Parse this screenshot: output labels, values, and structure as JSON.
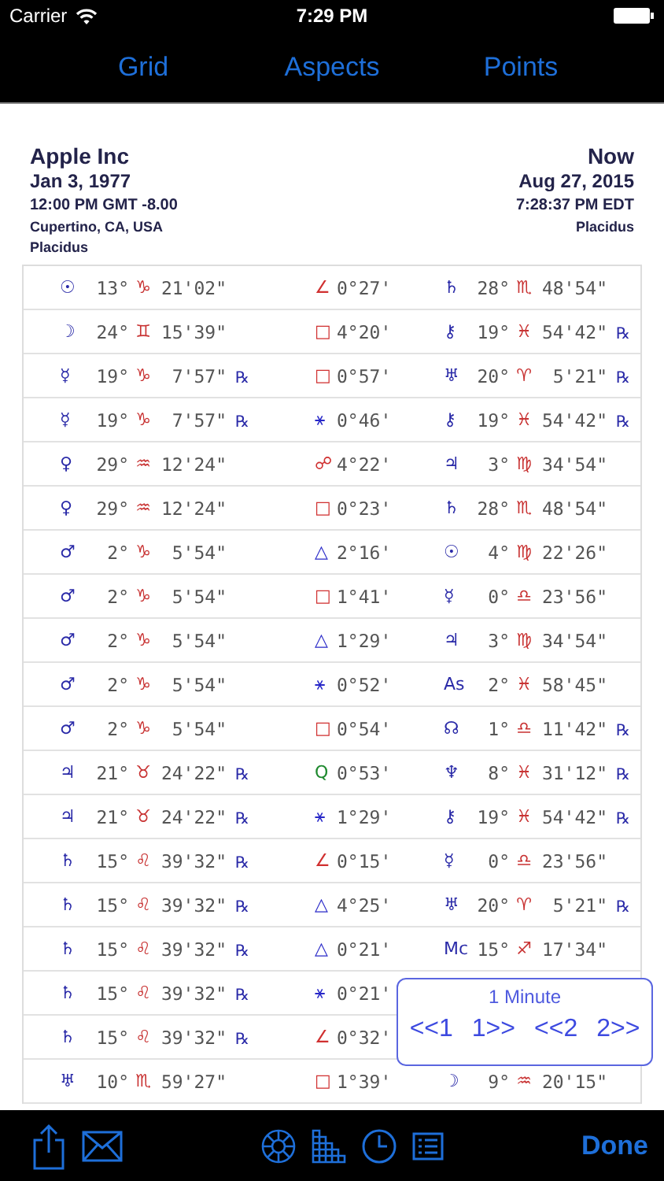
{
  "status_bar": {
    "carrier": "Carrier",
    "time": "7:29 PM"
  },
  "tabs": [
    {
      "label": "Grid",
      "selected": false
    },
    {
      "label": "Aspects",
      "selected": false
    },
    {
      "label": "Points",
      "selected": false
    }
  ],
  "chart1": {
    "name": "Apple Inc",
    "date": "Jan 3, 1977",
    "time": "12:00 PM GMT -8.00",
    "place": "Cupertino, CA, USA",
    "house_system": "Placidus"
  },
  "chart2": {
    "name": "Now",
    "date": "Aug 27, 2015",
    "time": "7:28:37 PM EDT",
    "house_system": "Placidus"
  },
  "rows": [
    {
      "p1": {
        "glyph": "☉",
        "deg": "13°",
        "sign": "♑",
        "min": "21'02\""
      },
      "aspect": {
        "glyph": "∠",
        "orb": "0°27'",
        "color": "#d03030"
      },
      "p2": {
        "glyph": "♄",
        "deg": "28°",
        "sign": "♏",
        "min": "48'54\""
      }
    },
    {
      "p1": {
        "glyph": "☽",
        "deg": "24°",
        "sign": "♊",
        "min": "15'39\""
      },
      "aspect": {
        "glyph": "□",
        "orb": "4°20'",
        "color": "#d03030"
      },
      "p2": {
        "glyph": "⚷",
        "deg": "19°",
        "sign": "♓",
        "min": "54'42\"",
        "retro": "℞"
      }
    },
    {
      "p1": {
        "glyph": "☿",
        "deg": "19°",
        "sign": "♑",
        "min": "7'57\"",
        "retro": "℞"
      },
      "aspect": {
        "glyph": "□",
        "orb": "0°57'",
        "color": "#d03030"
      },
      "p2": {
        "glyph": "♅",
        "deg": "20°",
        "sign": "♈",
        "min": "5'21\"",
        "retro": "℞"
      }
    },
    {
      "p1": {
        "glyph": "☿",
        "deg": "19°",
        "sign": "♑",
        "min": "7'57\"",
        "retro": "℞"
      },
      "aspect": {
        "glyph": "⚹",
        "orb": "0°46'",
        "color": "#2828c8"
      },
      "p2": {
        "glyph": "⚷",
        "deg": "19°",
        "sign": "♓",
        "min": "54'42\"",
        "retro": "℞"
      }
    },
    {
      "p1": {
        "glyph": "♀",
        "deg": "29°",
        "sign": "♒",
        "min": "12'24\""
      },
      "aspect": {
        "glyph": "☍",
        "orb": "4°22'",
        "color": "#d03030"
      },
      "p2": {
        "glyph": "♃",
        "deg": "3°",
        "sign": "♍",
        "min": "34'54\""
      }
    },
    {
      "p1": {
        "glyph": "♀",
        "deg": "29°",
        "sign": "♒",
        "min": "12'24\""
      },
      "aspect": {
        "glyph": "□",
        "orb": "0°23'",
        "color": "#d03030"
      },
      "p2": {
        "glyph": "♄",
        "deg": "28°",
        "sign": "♏",
        "min": "48'54\""
      }
    },
    {
      "p1": {
        "glyph": "♂",
        "deg": "2°",
        "sign": "♑",
        "min": "5'54\""
      },
      "aspect": {
        "glyph": "△",
        "orb": "2°16'",
        "color": "#2828c8"
      },
      "p2": {
        "glyph": "☉",
        "deg": "4°",
        "sign": "♍",
        "min": "22'26\""
      }
    },
    {
      "p1": {
        "glyph": "♂",
        "deg": "2°",
        "sign": "♑",
        "min": "5'54\""
      },
      "aspect": {
        "glyph": "□",
        "orb": "1°41'",
        "color": "#d03030"
      },
      "p2": {
        "glyph": "☿",
        "deg": "0°",
        "sign": "♎",
        "min": "23'56\""
      }
    },
    {
      "p1": {
        "glyph": "♂",
        "deg": "2°",
        "sign": "♑",
        "min": "5'54\""
      },
      "aspect": {
        "glyph": "△",
        "orb": "1°29'",
        "color": "#2828c8"
      },
      "p2": {
        "glyph": "♃",
        "deg": "3°",
        "sign": "♍",
        "min": "34'54\""
      }
    },
    {
      "p1": {
        "glyph": "♂",
        "deg": "2°",
        "sign": "♑",
        "min": "5'54\""
      },
      "aspect": {
        "glyph": "⚹",
        "orb": "0°52'",
        "color": "#2828c8"
      },
      "p2": {
        "glyph": "As",
        "deg": "2°",
        "sign": "♓",
        "min": "58'45\""
      }
    },
    {
      "p1": {
        "glyph": "♂",
        "deg": "2°",
        "sign": "♑",
        "min": "5'54\""
      },
      "aspect": {
        "glyph": "□",
        "orb": "0°54'",
        "color": "#d03030"
      },
      "p2": {
        "glyph": "☊",
        "deg": "1°",
        "sign": "♎",
        "min": "11'42\"",
        "retro": "℞"
      }
    },
    {
      "p1": {
        "glyph": "♃",
        "deg": "21°",
        "sign": "♉",
        "min": "24'22\"",
        "retro": "℞"
      },
      "aspect": {
        "glyph": "Q",
        "orb": "0°53'",
        "color": "#208a30"
      },
      "p2": {
        "glyph": "♆",
        "deg": "8°",
        "sign": "♓",
        "min": "31'12\"",
        "retro": "℞"
      }
    },
    {
      "p1": {
        "glyph": "♃",
        "deg": "21°",
        "sign": "♉",
        "min": "24'22\"",
        "retro": "℞"
      },
      "aspect": {
        "glyph": "⚹",
        "orb": "1°29'",
        "color": "#2828c8"
      },
      "p2": {
        "glyph": "⚷",
        "deg": "19°",
        "sign": "♓",
        "min": "54'42\"",
        "retro": "℞"
      }
    },
    {
      "p1": {
        "glyph": "♄",
        "deg": "15°",
        "sign": "♌",
        "min": "39'32\"",
        "retro": "℞"
      },
      "aspect": {
        "glyph": "∠",
        "orb": "0°15'",
        "color": "#d03030"
      },
      "p2": {
        "glyph": "☿",
        "deg": "0°",
        "sign": "♎",
        "min": "23'56\""
      }
    },
    {
      "p1": {
        "glyph": "♄",
        "deg": "15°",
        "sign": "♌",
        "min": "39'32\"",
        "retro": "℞"
      },
      "aspect": {
        "glyph": "△",
        "orb": "4°25'",
        "color": "#2828c8"
      },
      "p2": {
        "glyph": "♅",
        "deg": "20°",
        "sign": "♈",
        "min": "5'21\"",
        "retro": "℞"
      }
    },
    {
      "p1": {
        "glyph": "♄",
        "deg": "15°",
        "sign": "♌",
        "min": "39'32\"",
        "retro": "℞"
      },
      "aspect": {
        "glyph": "△",
        "orb": "0°21'",
        "color": "#2828c8"
      },
      "p2": {
        "glyph": "Mc",
        "deg": "15°",
        "sign": "♐",
        "min": "17'34\""
      }
    },
    {
      "p1": {
        "glyph": "♄",
        "deg": "15°",
        "sign": "♌",
        "min": "39'32\"",
        "retro": "℞"
      },
      "aspect": {
        "glyph": "⚹",
        "orb": "0°21'",
        "color": "#2828c8"
      }
    },
    {
      "p1": {
        "glyph": "♄",
        "deg": "15°",
        "sign": "♌",
        "min": "39'32\"",
        "retro": "℞"
      },
      "aspect": {
        "glyph": "∠",
        "orb": "0°32'",
        "color": "#d03030"
      }
    },
    {
      "p1": {
        "glyph": "♅",
        "deg": "10°",
        "sign": "♏",
        "min": "59'27\""
      },
      "aspect": {
        "glyph": "□",
        "orb": "1°39'",
        "color": "#d03030"
      },
      "p2": {
        "glyph": "☽",
        "deg": "9°",
        "sign": "♒",
        "min": "20'15\""
      }
    }
  ],
  "step_popup": {
    "title": "1 Minute",
    "buttons": [
      "<<1",
      "1>>",
      "<<2",
      "2>>"
    ]
  },
  "toolbar": {
    "done": "Done"
  }
}
